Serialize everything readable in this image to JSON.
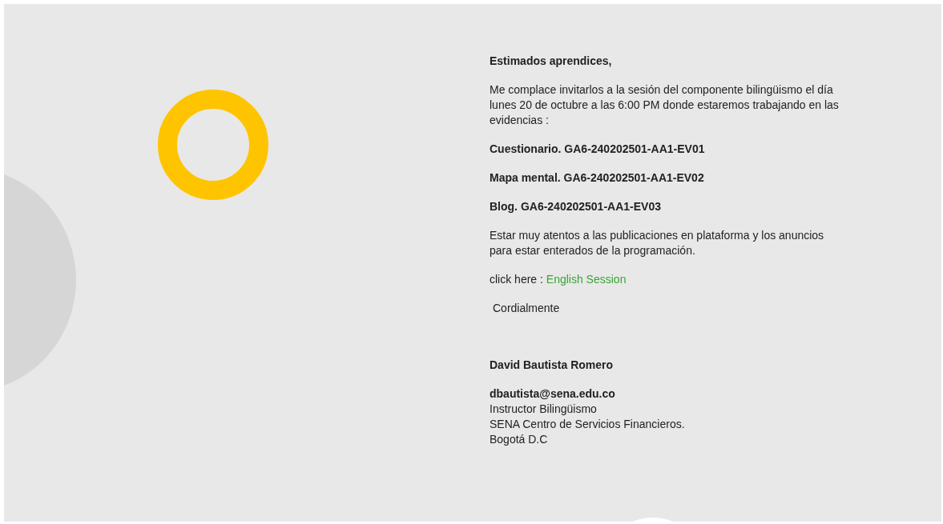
{
  "message": {
    "greeting": "Estimados aprendices,",
    "intro": "Me complace invitarlos a la sesión del componente bilingüismo el día lunes 20 de octubre a las 6:00 PM donde estaremos trabajando en las evidencias :",
    "evidences": [
      "Cuestionario. GA6-240202501-AA1-EV01",
      "Mapa mental. GA6-240202501-AA1-EV02",
      "Blog. GA6-240202501-AA1-EV03"
    ],
    "notice": "Estar muy atentos a las publicaciones en plataforma y los anuncios para estar enterados de la programación.",
    "link_prefix": "click here :",
    "link": "English Session",
    "closing": "Cordialmente"
  },
  "signature": {
    "name": "David Bautista Romero",
    "email": "dbautista@sena.edu.co",
    "lines": [
      "Instructor Bilingüismo",
      "SENA Centro de Servicios Financieros.",
      "Bogotá D.C"
    ]
  }
}
